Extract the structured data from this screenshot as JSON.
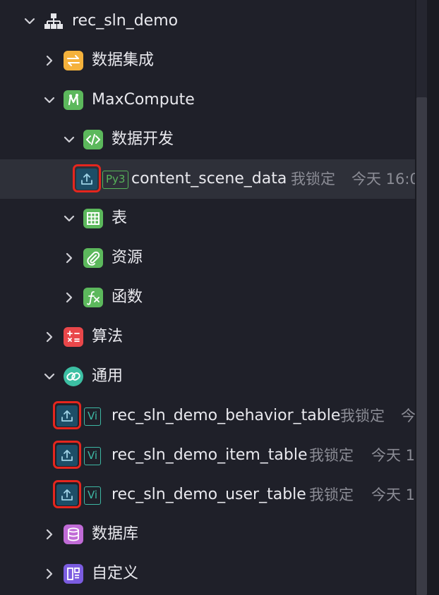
{
  "tree": {
    "root": {
      "label": "rec_sln_demo"
    },
    "data_integration": {
      "label": "数据集成"
    },
    "maxcompute": {
      "label": "MaxCompute"
    },
    "data_dev": {
      "label": "数据开发"
    },
    "content_scene_data": {
      "label": "content_scene_data",
      "badge": "Py3",
      "lock": "我锁定",
      "time": "今天 16:0"
    },
    "table": {
      "label": "表"
    },
    "resource": {
      "label": "资源"
    },
    "function": {
      "label": "函数"
    },
    "algorithm": {
      "label": "算法"
    },
    "general": {
      "label": "通用"
    },
    "behavior_table": {
      "label": "rec_sln_demo_behavior_table",
      "badge": "Vi",
      "lock": "我锁定",
      "time": "今"
    },
    "item_table": {
      "label": "rec_sln_demo_item_table",
      "badge": "Vi",
      "lock": "我锁定",
      "time": "今天 1"
    },
    "user_table": {
      "label": "rec_sln_demo_user_table",
      "badge": "Vi",
      "lock": "我锁定",
      "time": "今天 1"
    },
    "database": {
      "label": "数据库"
    },
    "custom": {
      "label": "自定义"
    }
  },
  "colors": {
    "background": "#1f2029",
    "selected_row": "#2e3039",
    "highlight_box": "#e5261e",
    "data_integration_icon": "#f5b23c",
    "maxcompute_icon": "#5cb85c",
    "algorithm_icon": "#e9474a",
    "general_icon": "#3cbfa3",
    "database_icon": "#c06bd6",
    "custom_icon": "#7b5ce0"
  },
  "icons": {
    "root": "hierarchy-icon",
    "data_integration": "swap-arrows-icon",
    "maxcompute": "maxcompute-logo-icon",
    "data_dev": "code-icon",
    "table": "grid-icon",
    "resource": "paperclip-icon",
    "function": "fx-icon",
    "algorithm": "calculator-icon",
    "general": "link-icon",
    "database": "database-icon",
    "custom": "custom-widgets-icon",
    "upload": "upload-icon"
  }
}
